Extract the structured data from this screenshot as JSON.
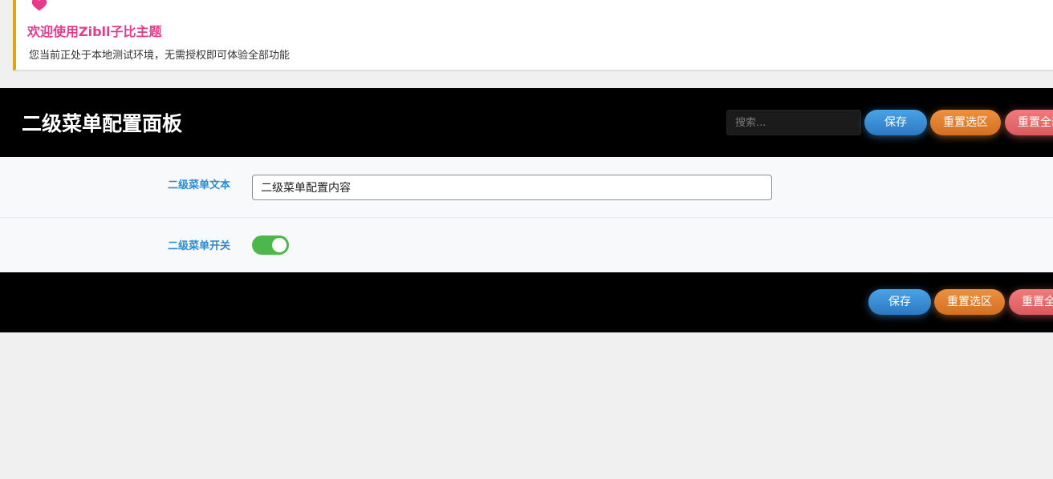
{
  "notice": {
    "icon": "heart-icon",
    "title": "欢迎使用Zibll子比主题",
    "description": "您当前正处于本地测试环境，无需授权即可体验全部功能"
  },
  "header": {
    "title": "二级菜单配置面板",
    "search_placeholder": "搜索...",
    "save_label": "保存",
    "reset_section_label": "重置选区",
    "reset_all_label": "重置全部"
  },
  "fields": {
    "text": {
      "label": "二级菜单文本",
      "value": "二级菜单配置内容"
    },
    "switch": {
      "label": "二级菜单开关",
      "state": true
    }
  },
  "footer": {
    "save_label": "保存",
    "reset_section_label": "重置选区",
    "reset_all_label": "重置全部"
  },
  "colors": {
    "notice_title": "#e8398b",
    "notice_border": "#dba617",
    "label": "#2a8bd2",
    "switch_on": "#4cb84c",
    "save": "#3a8fd6",
    "reset_section": "#e07f30",
    "reset_all": "#e56b6e"
  }
}
